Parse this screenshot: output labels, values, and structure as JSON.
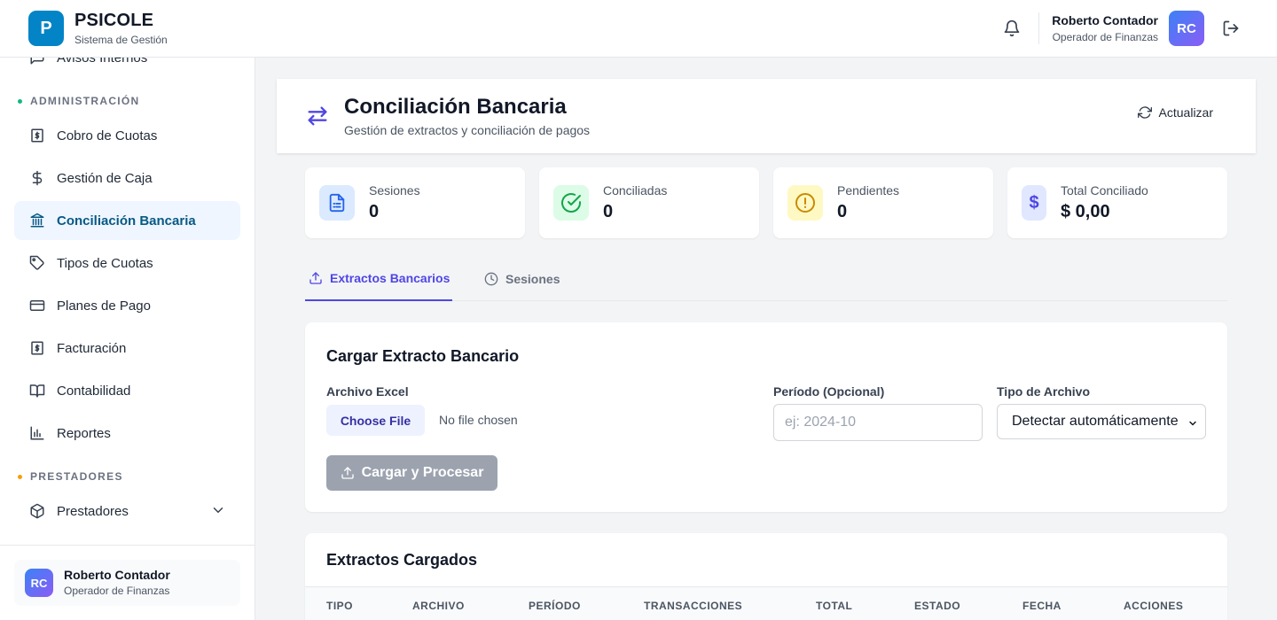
{
  "header": {
    "brand_initial": "P",
    "brand_name": "PSICOLE",
    "brand_subtitle": "Sistema de Gestión",
    "user_name": "Roberto Contador",
    "user_role": "Operador de Finanzas",
    "user_initials": "RC"
  },
  "sidebar": {
    "partial_item": "Avisos Internos",
    "section_admin": "ADMINISTRACIÓN",
    "section_admin_color": "#10b981",
    "items": [
      {
        "label": "Cobro de Cuotas",
        "icon": "receipt-dollar-icon"
      },
      {
        "label": "Gestión de Caja",
        "icon": "dollar-icon"
      },
      {
        "label": "Conciliación Bancaria",
        "icon": "bank-icon",
        "active": true
      },
      {
        "label": "Tipos de Cuotas",
        "icon": "tags-icon"
      },
      {
        "label": "Planes de Pago",
        "icon": "credit-card-icon"
      },
      {
        "label": "Facturación",
        "icon": "invoice-icon"
      },
      {
        "label": "Contabilidad",
        "icon": "book-icon"
      },
      {
        "label": "Reportes",
        "icon": "bar-chart-icon"
      }
    ],
    "section_providers": "PRESTADORES",
    "section_providers_color": "#f59e0b",
    "providers_item": "Prestadores",
    "footer_name": "Roberto Contador",
    "footer_role": "Operador de Finanzas",
    "footer_initials": "RC"
  },
  "page": {
    "title": "Conciliación Bancaria",
    "subtitle": "Gestión de extractos y conciliación de pagos",
    "refresh_label": "Actualizar"
  },
  "stats": [
    {
      "label": "Sesiones",
      "value": "0",
      "icon": "document-list-icon",
      "bg": "#dbeafe",
      "fg": "#2563eb"
    },
    {
      "label": "Conciliadas",
      "value": "0",
      "icon": "check-circle-icon",
      "bg": "#dcfce7",
      "fg": "#16a34a"
    },
    {
      "label": "Pendientes",
      "value": "0",
      "icon": "alert-circle-icon",
      "bg": "#fef9c3",
      "fg": "#ca8a04"
    },
    {
      "label": "Total Conciliado",
      "value": "$ 0,00",
      "icon": "dollar-sign-icon",
      "bg": "#e0e7ff",
      "fg": "#4f46e5"
    }
  ],
  "tabs": [
    {
      "label": "Extractos Bancarios",
      "active": true
    },
    {
      "label": "Sesiones",
      "active": false
    }
  ],
  "upload": {
    "title": "Cargar Extracto Bancario",
    "file_label": "Archivo Excel",
    "file_button": "Choose File",
    "file_status": "No file chosen",
    "period_label": "Período (Opcional)",
    "period_placeholder": "ej: 2024-10",
    "type_label": "Tipo de Archivo",
    "type_value": "Detectar automáticamente",
    "submit_label": "Cargar y Procesar"
  },
  "extracts": {
    "title": "Extractos Cargados",
    "columns": [
      "TIPO",
      "ARCHIVO",
      "PERÍODO",
      "TRANSACCIONES",
      "TOTAL",
      "ESTADO",
      "FECHA",
      "ACCIONES"
    ]
  },
  "colors": {
    "primary": "#0284c7",
    "accent": "#4f46e5",
    "active_nav_text": "#075985"
  }
}
